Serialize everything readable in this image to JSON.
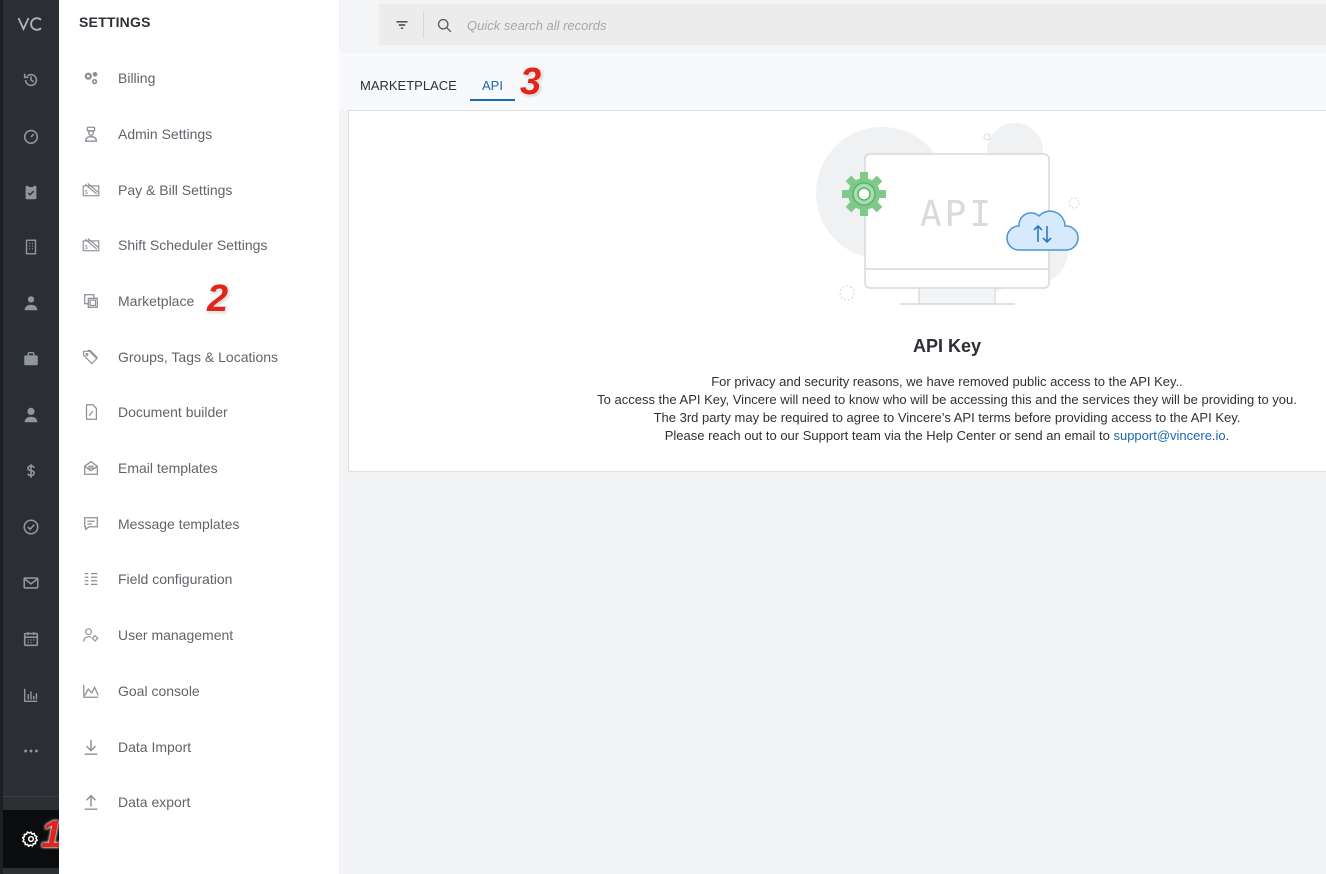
{
  "rail": {
    "logo_text": "VC",
    "icons": [
      "history-icon",
      "dashboard-icon",
      "clipboard-icon",
      "building-icon",
      "candidate-icon",
      "briefcase-icon",
      "person-icon",
      "dollar-icon",
      "check-circle-icon",
      "mail-icon",
      "calendar-icon",
      "bar-chart-icon",
      "more-icon"
    ],
    "active": "settings-gear-icon"
  },
  "settings_panel": {
    "title": "SETTINGS",
    "items": [
      {
        "label": "Billing",
        "icon": "gears-icon"
      },
      {
        "label": "Admin Settings",
        "icon": "admin-icon"
      },
      {
        "label": "Pay & Bill Settings",
        "icon": "pay-bill-icon"
      },
      {
        "label": "Shift Scheduler Settings",
        "icon": "shift-scheduler-icon"
      },
      {
        "label": "Marketplace",
        "icon": "marketplace-icon"
      },
      {
        "label": "Groups, Tags & Locations",
        "icon": "tag-icon"
      },
      {
        "label": "Document builder",
        "icon": "document-icon"
      },
      {
        "label": "Email templates",
        "icon": "email-template-icon"
      },
      {
        "label": "Message templates",
        "icon": "message-icon"
      },
      {
        "label": "Field configuration",
        "icon": "field-config-icon"
      },
      {
        "label": "User management",
        "icon": "user-gear-icon"
      },
      {
        "label": "Goal console",
        "icon": "goal-chart-icon"
      },
      {
        "label": "Data Import",
        "icon": "download-icon"
      },
      {
        "label": "Data export",
        "icon": "upload-icon"
      }
    ]
  },
  "search": {
    "placeholder": "Quick search all records"
  },
  "tabs": [
    {
      "label": "MARKETPLACE",
      "active": false
    },
    {
      "label": "API",
      "active": true
    }
  ],
  "annotations": {
    "step1": "1",
    "step2": "2",
    "step3": "3"
  },
  "card": {
    "illustration_text": "API",
    "title": "API Key",
    "lines": [
      "For privacy and security reasons, we have removed public access to the API Key..",
      "To access the API Key, Vincere will need to know who will be accessing this and the services they will be providing to you.",
      "The 3rd party may be required to agree to Vincere’s API terms before providing access to the API Key."
    ],
    "last_line_prefix": "Please reach out to our Support team via the Help Center or send an email to ",
    "support_email": "support@vincere.io",
    "last_line_suffix": "."
  },
  "colors": {
    "accent": "#1b67b0",
    "badge": "#e3241b",
    "rail": "#2b2f33"
  }
}
